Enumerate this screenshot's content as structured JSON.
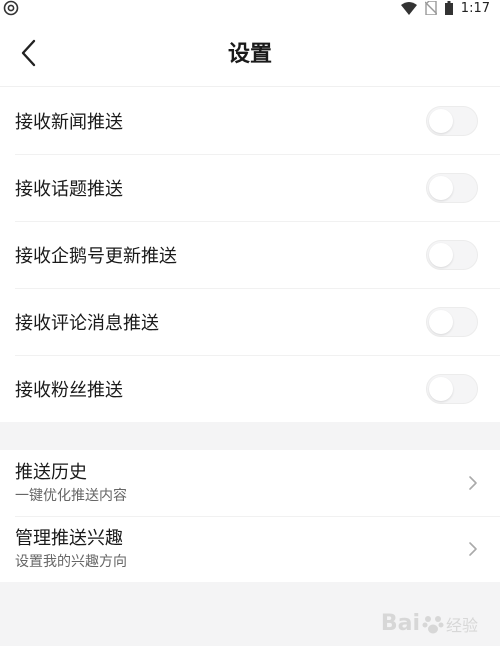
{
  "status_bar": {
    "time": "1:17",
    "left_icon": "app-notification-icon",
    "right_icons": [
      "wifi-icon",
      "no-sim-icon",
      "battery-icon"
    ]
  },
  "header": {
    "title": "设置",
    "back_icon": "back-chevron-icon"
  },
  "push_toggles": [
    {
      "label": "接收新闻推送",
      "on": false
    },
    {
      "label": "接收话题推送",
      "on": false
    },
    {
      "label": "接收企鹅号更新推送",
      "on": false
    },
    {
      "label": "接收评论消息推送",
      "on": false
    },
    {
      "label": "接收粉丝推送",
      "on": false
    }
  ],
  "nav_items": [
    {
      "title": "推送历史",
      "subtitle": "一键优化推送内容"
    },
    {
      "title": "管理推送兴趣",
      "subtitle": "设置我的兴趣方向"
    }
  ],
  "watermark": {
    "text": "Bai",
    "suffix": "经验"
  },
  "colors": {
    "background": "#f4f4f5",
    "card": "#ffffff",
    "switch_off": "#f5f5f6"
  }
}
